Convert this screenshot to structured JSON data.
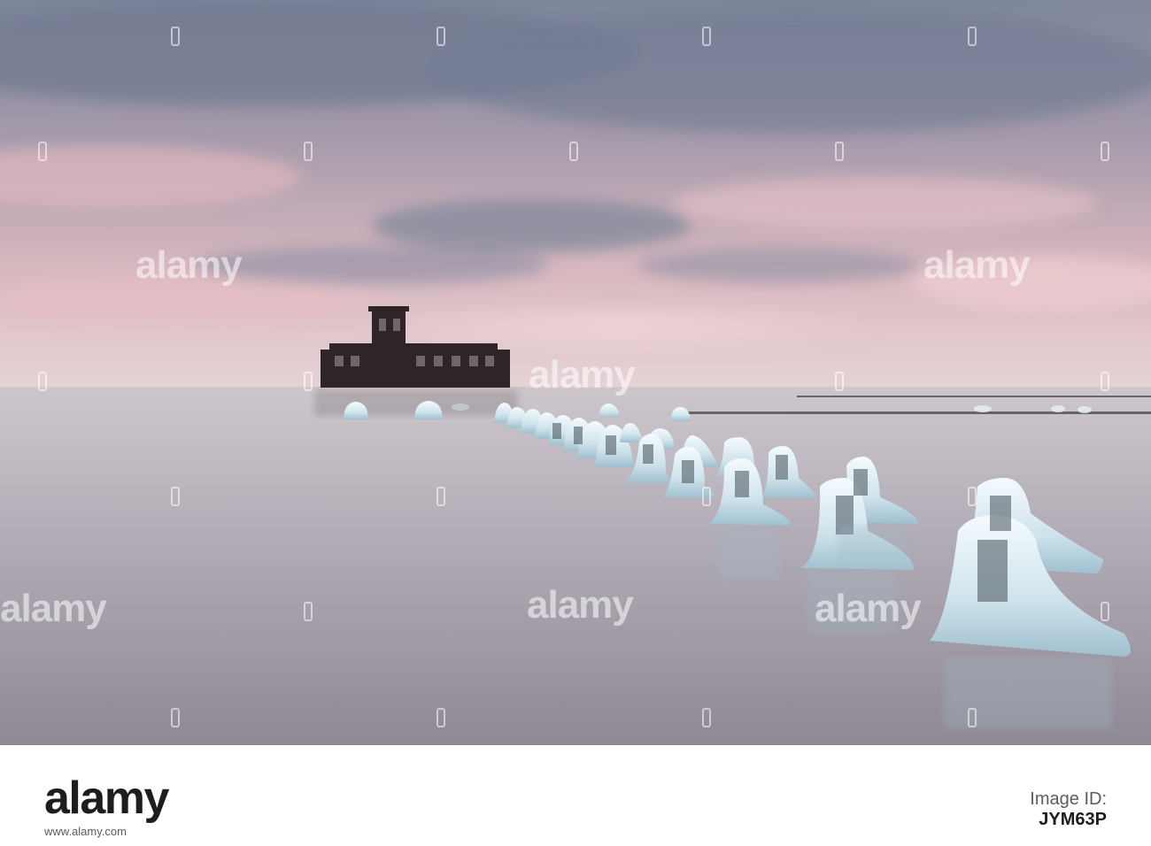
{
  "photo": {
    "watermark_text": "alamy",
    "colors": {
      "sky_top": "#8a93a6",
      "sky_mid": "#d6b8bf",
      "sky_horizon": "#e3cccf",
      "water_top": "#c7bfc6",
      "water_bottom": "#8f8a95",
      "ice": "#eaf4f8",
      "ice_shadow": "#8fb4c6",
      "ruin": "#2e2426"
    }
  },
  "footer": {
    "brand": "alamy",
    "id_label": "Image ID:",
    "image_id": "JYM63P",
    "url": "www.alamy.com"
  }
}
